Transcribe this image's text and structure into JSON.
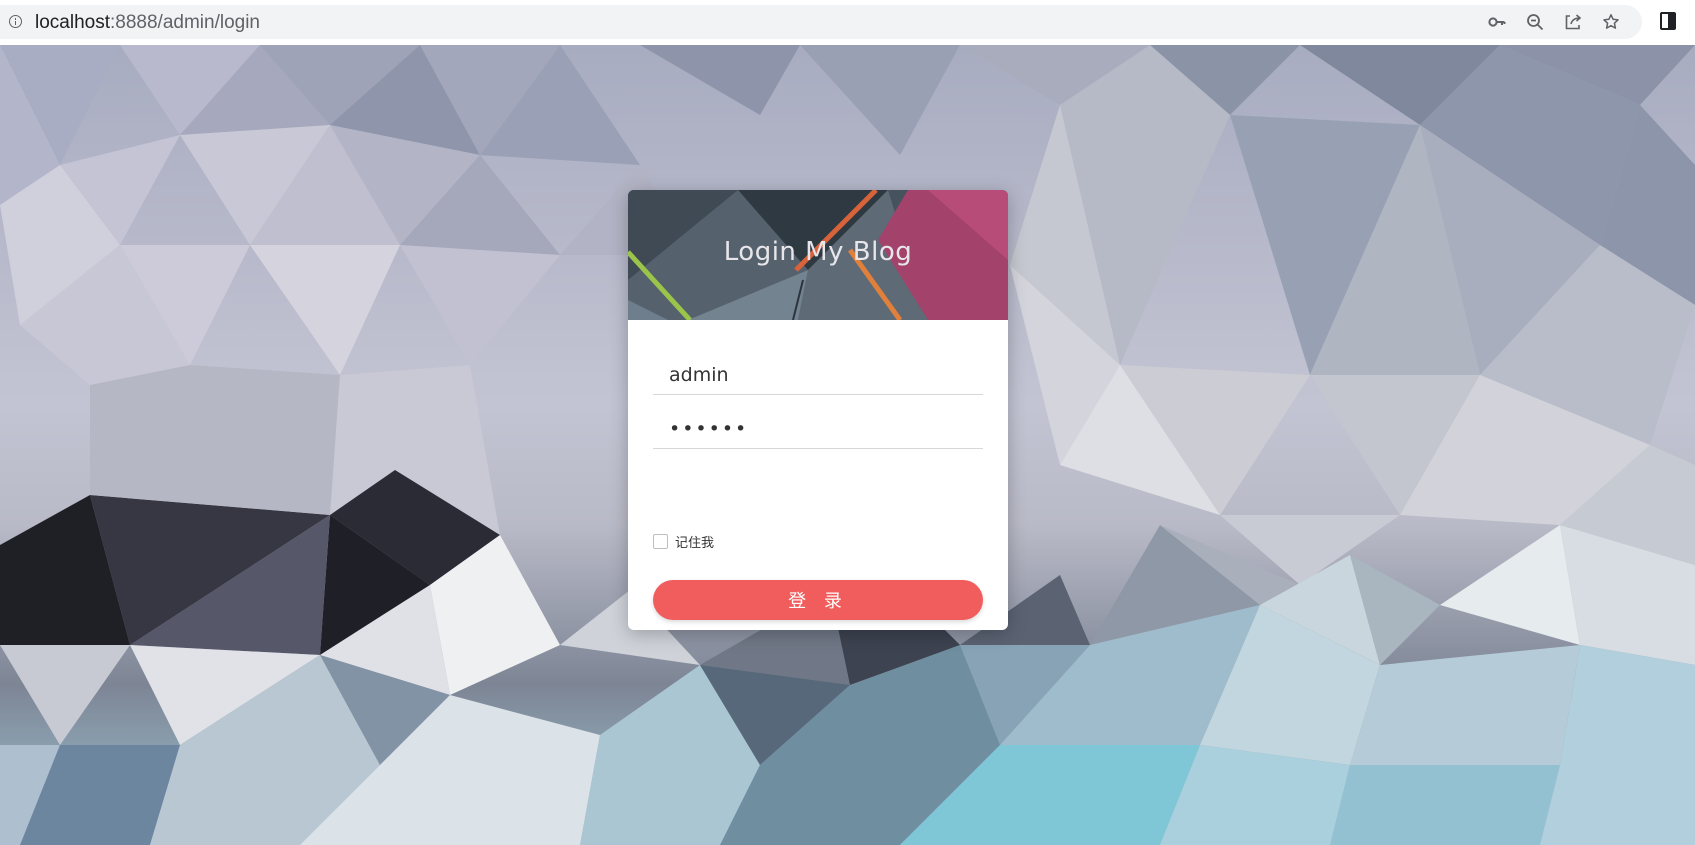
{
  "browser": {
    "url_host": "localhost",
    "url_path": ":8888/admin/login",
    "icons": [
      "info-icon",
      "key-icon",
      "zoom-out-icon",
      "share-icon",
      "star-icon",
      "side-panel-icon"
    ]
  },
  "login": {
    "title": "Login My Blog",
    "username_value": "admin",
    "password_value": "••••••",
    "remember_label": "记住我",
    "remember_checked": false,
    "submit_label": "登 录"
  },
  "colors": {
    "button": "#f15d5c",
    "header_pink": "#b5436f",
    "header_orange": "#e0703a",
    "header_green": "#9bc54a",
    "header_dark": "#3e4953"
  }
}
